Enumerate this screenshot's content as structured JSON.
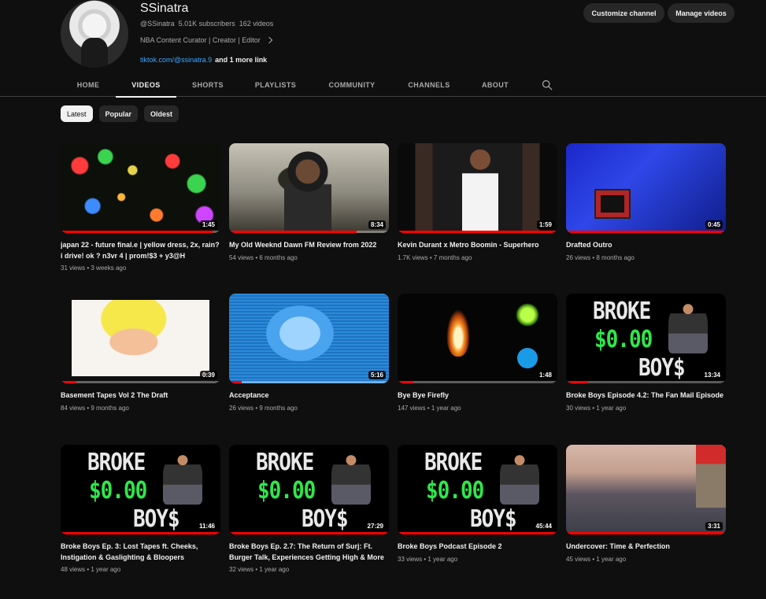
{
  "channel": {
    "name": "SSinatra",
    "handle": "@SSinatra",
    "subscribers": "5.01K subscribers",
    "videos_count": "162 videos",
    "description": "NBA Content Curator | Creator | Editor",
    "link": "tiktok.com/@ssinatra.9",
    "more_links": "and 1 more link",
    "customize_label": "Customize channel",
    "manage_label": "Manage videos"
  },
  "tabs": [
    {
      "label": "HOME"
    },
    {
      "label": "VIDEOS"
    },
    {
      "label": "SHORTS"
    },
    {
      "label": "PLAYLISTS"
    },
    {
      "label": "COMMUNITY"
    },
    {
      "label": "CHANNELS"
    },
    {
      "label": "ABOUT"
    }
  ],
  "active_tab": "VIDEOS",
  "chips": [
    {
      "label": "Latest",
      "active": true
    },
    {
      "label": "Popular",
      "active": false
    },
    {
      "label": "Oldest",
      "active": false
    }
  ],
  "videos": [
    {
      "title": "japan 22 - future final.e | yellow dress, 2x, rain? i drive! ok ? n3vr 4 | prom!$3 + y3@H",
      "stats": "31 views • 3 weeks ago",
      "duration": "1:45",
      "progress": 0.95,
      "art": "bokeh"
    },
    {
      "title": "My Old Weeknd Dawn FM Review from 2022",
      "stats": "54 views • 6 months ago",
      "duration": "8:34",
      "progress": 0.8,
      "art": "weeknd"
    },
    {
      "title": "Kevin Durant x Metro Boomin - Superhero",
      "stats": "1.7K views • 7 months ago",
      "duration": "1:59",
      "progress": 1.0,
      "art": "kd"
    },
    {
      "title": "Drafted Outro",
      "stats": "26 views • 8 months ago",
      "duration": "0:45",
      "progress": 1.0,
      "art": "drafted"
    },
    {
      "title": "Basement Tapes Vol 2 The Draft",
      "stats": "84 views • 9 months ago",
      "duration": "0:39",
      "progress": 0.1,
      "art": "dbz"
    },
    {
      "title": "Acceptance",
      "stats": "26 views • 9 months ago",
      "duration": "5:16",
      "progress": 0.08,
      "art": "accept"
    },
    {
      "title": "Bye Bye Firefly",
      "stats": "147 views • 1 year ago",
      "duration": "1:48",
      "progress": 0.1,
      "art": "flame"
    },
    {
      "title": "Broke Boys Episode 4.2: The Fan Mail Episode",
      "stats": "30 views • 1 year ago",
      "duration": "13:34",
      "progress": 0.14,
      "art": "broke"
    },
    {
      "title": "Broke Boys Ep. 3: Lost Tapes ft. Cheeks, Instigation & Gaslighting & Bloopers",
      "stats": "48 views • 1 year ago",
      "duration": "11:46",
      "progress": 1.0,
      "art": "broke"
    },
    {
      "title": "Broke Boys Ep. 2.7: The Return of Surj: Ft. Burger Talk, Experiences Getting High & More",
      "stats": "32 views • 1 year ago",
      "duration": "27:29",
      "progress": 1.0,
      "art": "broke"
    },
    {
      "title": "Broke Boys Podcast Episode 2",
      "stats": "33 views • 1 year ago",
      "duration": "45:44",
      "progress": 1.0,
      "art": "broke"
    },
    {
      "title": "Undercover: Time & Perfection",
      "stats": "45 views • 1 year ago",
      "duration": "3:31",
      "progress": 1.0,
      "art": "city"
    }
  ],
  "broke_art_text": {
    "line1": "BROKE",
    "line2": "$0.00",
    "line3": "BOY$"
  }
}
